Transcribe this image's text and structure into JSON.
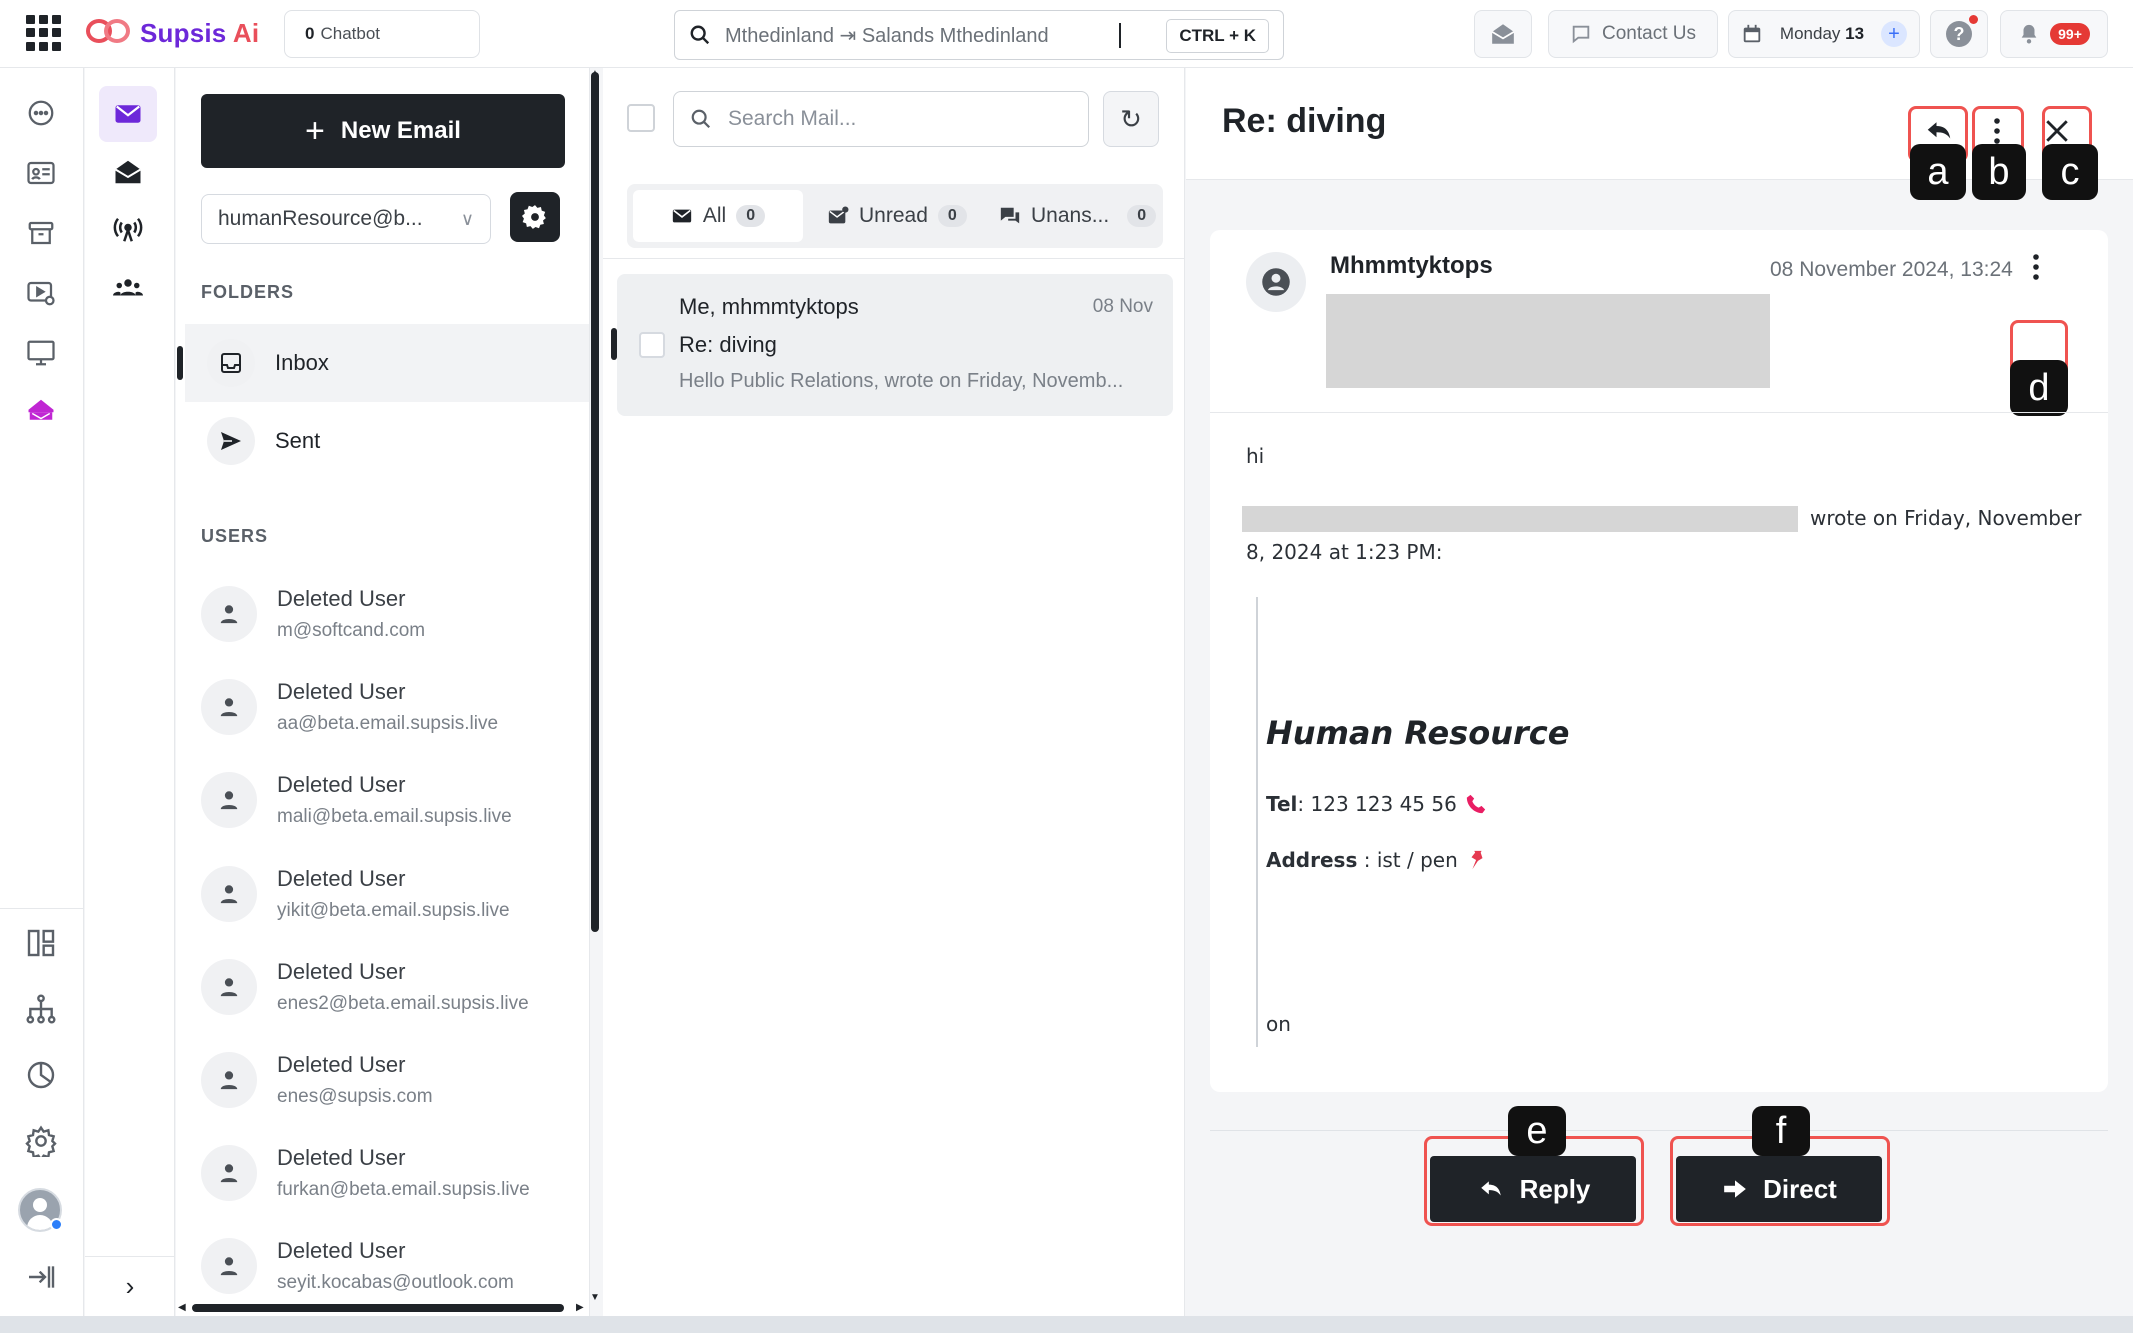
{
  "topbar": {
    "brand": "Supsis",
    "brand_suffix": "Ai",
    "chatbot_count": "0",
    "chatbot_label": "Chatbot",
    "search_text": "Mthedinland ⇥ Salands Mthedinland",
    "shortcut": "CTRL + K",
    "contact_label": "Contact Us",
    "date_day": "Monday",
    "date_num": "13",
    "notif_badge": "99+"
  },
  "folders_panel": {
    "new_email_label": "New Email",
    "account": "humanResource@b...",
    "folders_heading": "FOLDERS",
    "folders": [
      {
        "label": "Inbox",
        "active": true
      },
      {
        "label": "Sent",
        "active": false
      }
    ],
    "users_heading": "USERS",
    "users": [
      {
        "name": "Deleted User",
        "email": "m@softcand.com"
      },
      {
        "name": "Deleted User",
        "email": "aa@beta.email.supsis.live"
      },
      {
        "name": "Deleted User",
        "email": "mali@beta.email.supsis.live"
      },
      {
        "name": "Deleted User",
        "email": "yikit@beta.email.supsis.live"
      },
      {
        "name": "Deleted User",
        "email": "enes2@beta.email.supsis.live"
      },
      {
        "name": "Deleted User",
        "email": "enes@supsis.com"
      },
      {
        "name": "Deleted User",
        "email": "furkan@beta.email.supsis.live"
      },
      {
        "name": "Deleted User",
        "email": "seyit.kocabas@outlook.com"
      }
    ]
  },
  "mail_list": {
    "search_placeholder": "Search Mail...",
    "tabs": [
      {
        "label": "All",
        "count": "0"
      },
      {
        "label": "Unread",
        "count": "0"
      },
      {
        "label": "Unans...",
        "count": "0"
      }
    ],
    "items": [
      {
        "from": "Me, mhmmtyktops",
        "date": "08 Nov",
        "subject": "Re: diving",
        "preview": "Hello Public Relations, wrote on Friday, Novemb..."
      }
    ]
  },
  "detail": {
    "title": "Re: diving",
    "sender": "Mhmmtyktops",
    "date": "08 November 2024, 13:24",
    "body_greeting": "hi",
    "quote_header_tail": "wrote on Friday, November",
    "quote_header_line2": "8, 2024 at 1:23 PM:",
    "signature_name": "Human Resource",
    "tel_label": "Tel",
    "tel_value": ": 123 123 45 56",
    "address_label": "Address",
    "address_value": " : ist / pen",
    "body_tail": "on",
    "reply_label": "Reply",
    "direct_label": "Direct"
  },
  "annotations": {
    "a": "a",
    "b": "b",
    "c": "c",
    "d": "d",
    "e": "e",
    "f": "f",
    "box_color": "#ef5350"
  },
  "colors": {
    "accent": "#6d28d9",
    "brand_red": "#e94f5b",
    "dark": "#1f2328",
    "badge": "#e53935"
  }
}
